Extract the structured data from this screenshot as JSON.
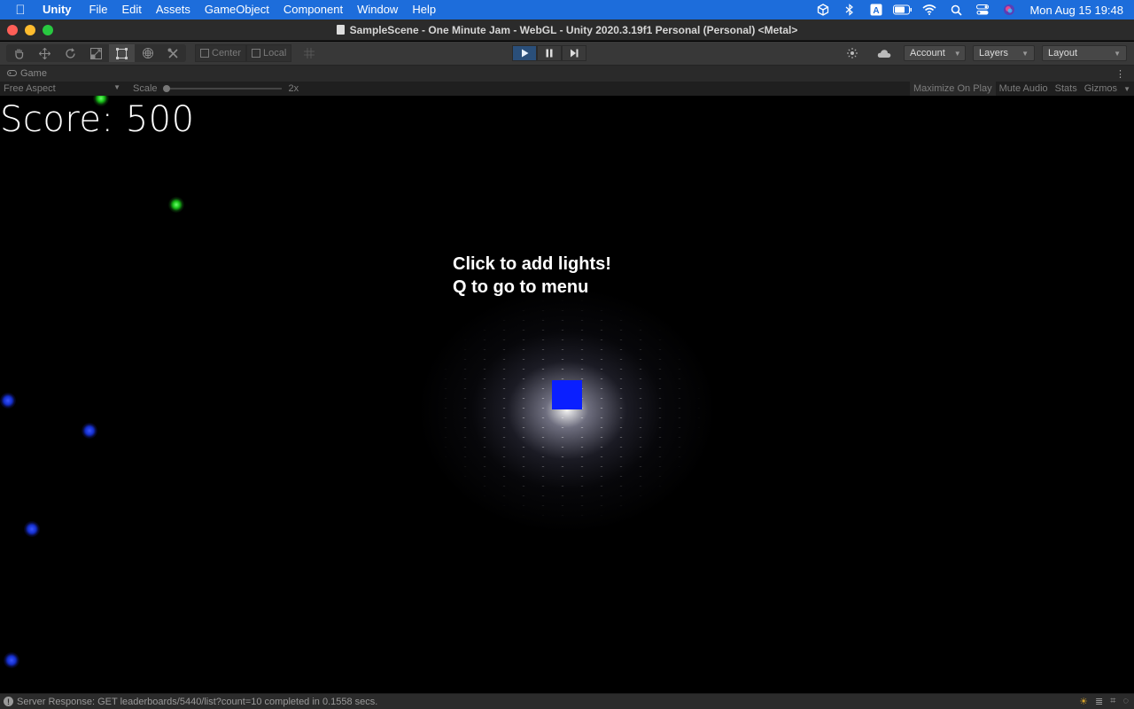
{
  "menubar": {
    "app": "Unity",
    "items": [
      "File",
      "Edit",
      "Assets",
      "GameObject",
      "Component",
      "Window",
      "Help"
    ],
    "clock": "Mon Aug 15  19:48"
  },
  "window": {
    "title": "SampleScene - One Minute Jam - WebGL - Unity 2020.3.19f1 Personal (Personal) <Metal>"
  },
  "toolbar": {
    "pivot_center": "Center",
    "pivot_local": "Local",
    "account": "Account",
    "layers": "Layers",
    "layout": "Layout"
  },
  "game_tab": {
    "label": "Game"
  },
  "game_bar": {
    "aspect": "Free Aspect",
    "scale_label": "Scale",
    "scale_value": "2x",
    "maximize": "Maximize On Play",
    "mute": "Mute Audio",
    "stats": "Stats",
    "gizmos": "Gizmos"
  },
  "game": {
    "score": "Score: 500",
    "hint_line1": "Click to add lights!",
    "hint_line2": "Q to go to menu",
    "player_color": "#0a1fff"
  },
  "status": {
    "message": "Server Response: GET leaderboards/5440/list?count=10 completed in 0.1558 secs."
  },
  "colors": {
    "menubar": "#1d6ddb",
    "green_light": "#18c018",
    "blue_light": "#1530d0"
  }
}
